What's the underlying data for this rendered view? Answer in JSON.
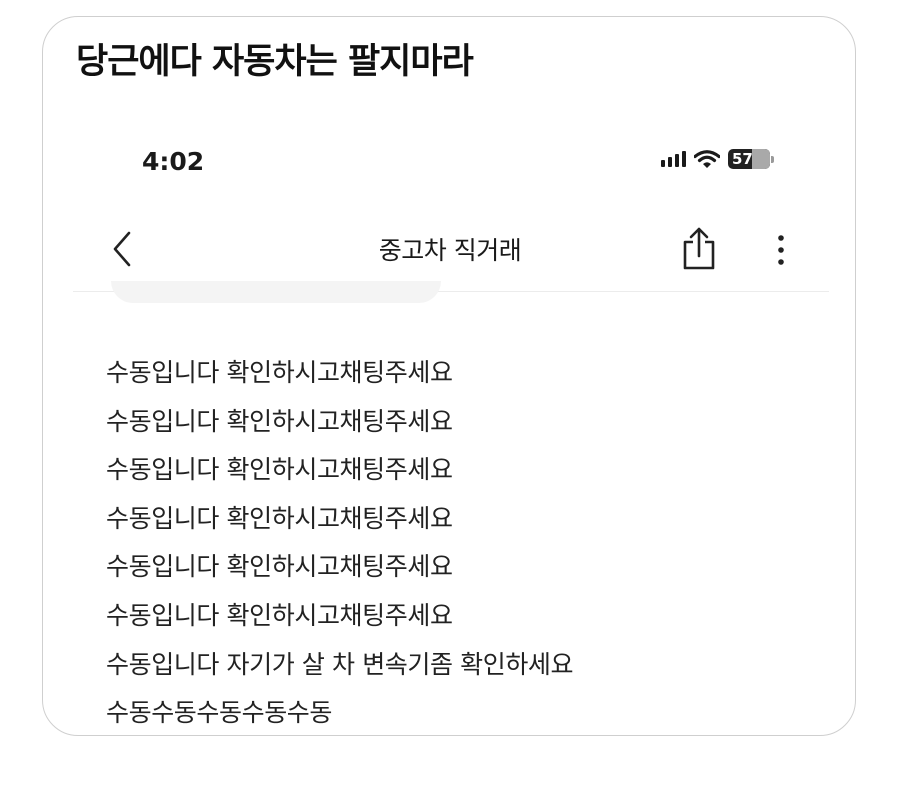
{
  "post": {
    "headline": "당근에다 자동차는 팔지마라"
  },
  "status_bar": {
    "time": "4:02",
    "battery": "57",
    "icons": [
      "signal-icon",
      "wifi-icon",
      "battery-icon"
    ]
  },
  "nav": {
    "title": "중고차 직거래",
    "back_icon": "chevron-left-icon",
    "share_icon": "share-icon",
    "more_icon": "more-vertical-icon"
  },
  "messages": [
    "수동입니다 확인하시고채팅주세요",
    "수동입니다 확인하시고채팅주세요",
    "수동입니다 확인하시고채팅주세요",
    "수동입니다 확인하시고채팅주세요",
    "수동입니다 확인하시고채팅주세요",
    "수동입니다 확인하시고채팅주세요",
    "수동입니다 자기가 살 차 변속기좀 확인하세요",
    "수동수동수동수동수동"
  ]
}
